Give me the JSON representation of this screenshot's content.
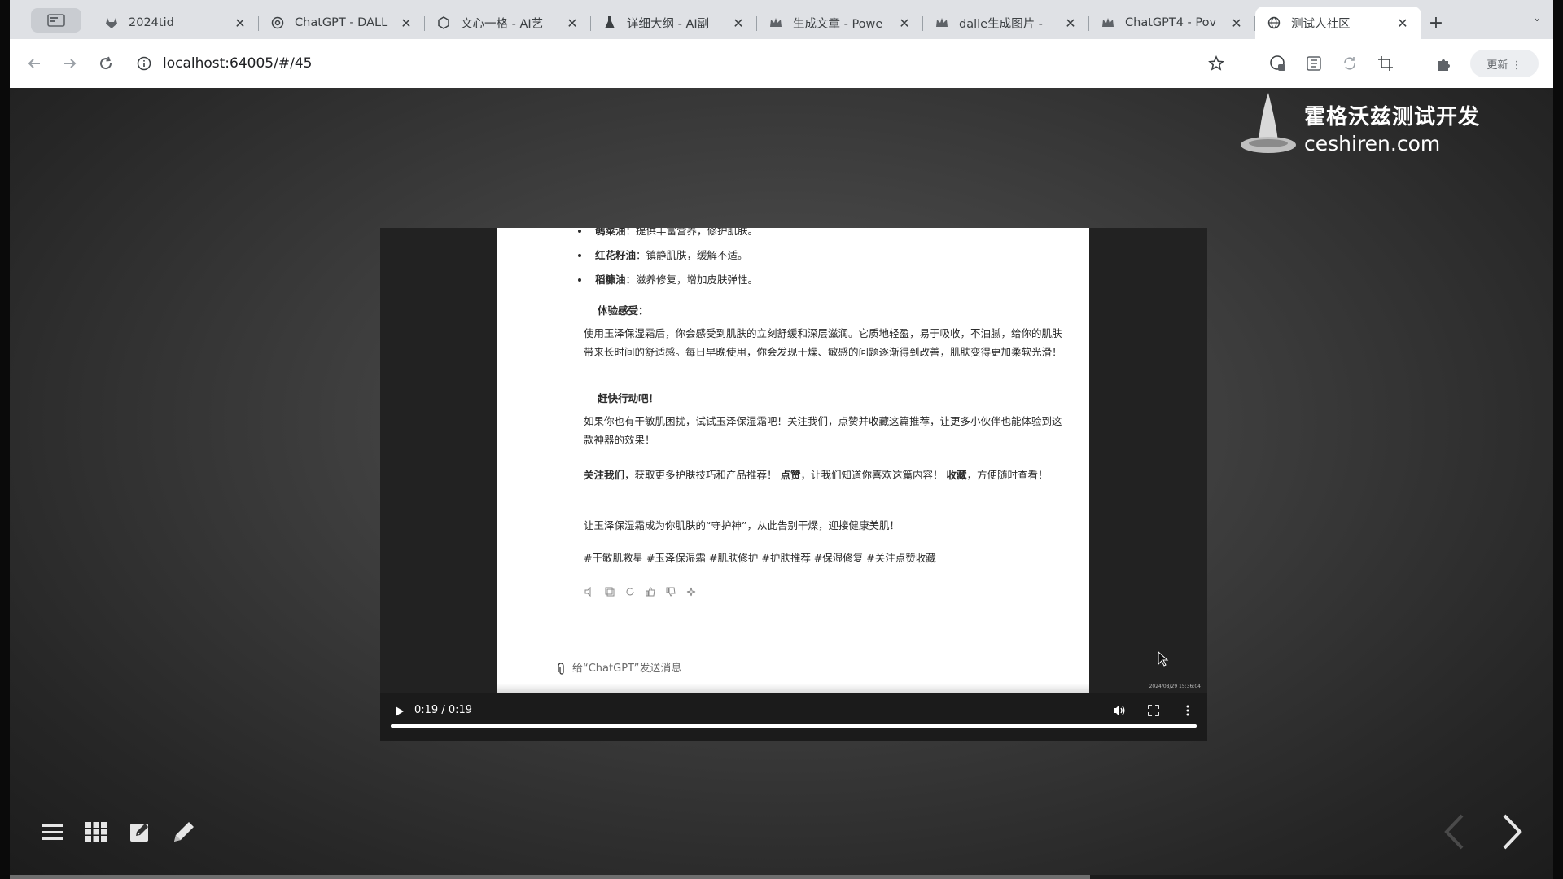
{
  "browser": {
    "tabs": [
      {
        "title": "2024tid",
        "icon": "gitlab-icon"
      },
      {
        "title": "ChatGPT - DALL",
        "icon": "openai-icon"
      },
      {
        "title": "文心一格 - AI艺",
        "icon": "wenxin-icon"
      },
      {
        "title": "详细大纲 - AI副",
        "icon": "flask-icon"
      },
      {
        "title": "生成文章 - Powe",
        "icon": "crown-icon"
      },
      {
        "title": "dalle生成图片 -",
        "icon": "crown-icon"
      },
      {
        "title": "ChatGPT4 - Pov",
        "icon": "crown-icon"
      },
      {
        "title": "测试人社区",
        "icon": "globe-icon"
      }
    ],
    "active_tab_index": 7,
    "new_tab_label": "+",
    "url": "localhost:64005/#/45",
    "profile_label": "更新 ⋮"
  },
  "logo": {
    "name_cn": "霍格沃兹测试开发",
    "domain": "ceshiren.com"
  },
  "document": {
    "bullets": [
      {
        "name": "鹌菜油",
        "desc": "：提供丰富营养，修护肌肤。"
      },
      {
        "name": "红花籽油",
        "desc": "：镇静肌肤，缓解不适。"
      },
      {
        "name": "稻糠油",
        "desc": "：滋养修复，增加皮肤弹性。"
      }
    ],
    "experience_heading": "体验感受：",
    "experience_text": "使用玉泽保湿霜后，你会感受到肌肤的立刻舒缓和深层滋润。它质地轻盈，易于吸收，不油腻，给你的肌肤带来长时间的舒适感。每日早晚使用，你会发现干燥、敏感的问题逐渐得到改善，肌肤变得更加柔软光滑！",
    "action_heading": "赶快行动吧！",
    "action_text": "如果你也有干敏肌困扰，试试玉泽保湿霜吧！关注我们，点赞并收藏这篇推荐，让更多小伙伴也能体验到这款神器的效果！",
    "follow_bold": "关注我们",
    "follow_text": "，获取更多护肤技巧和产品推荐！",
    "like_bold": "点赞",
    "like_text": "，让我们知道你喜欢这篇内容！",
    "save_bold": "收藏",
    "save_text": "，方便随时查看！",
    "closing_text": "让玉泽保湿霜成为你肌肤的“守护神”，从此告别干燥，迎接健康美肌！",
    "hashtags": "#干敏肌救星 #玉泽保湿霜 #肌肤修护 #护肤推荐 #保湿修复 #关注点赞收藏",
    "input_placeholder": "给“ChatGPT”发送消息",
    "timestamp": "2024/08/29 15:36:04"
  },
  "video": {
    "time_display": "0:19 / 0:19",
    "progress": 1.0
  },
  "slides": {
    "progress": 0.7
  },
  "colors": {
    "tabbar": "#dfe1e5",
    "toolbar": "#ffffff",
    "video_bg": "#222222",
    "controls_bg": "#1b1b1b"
  }
}
